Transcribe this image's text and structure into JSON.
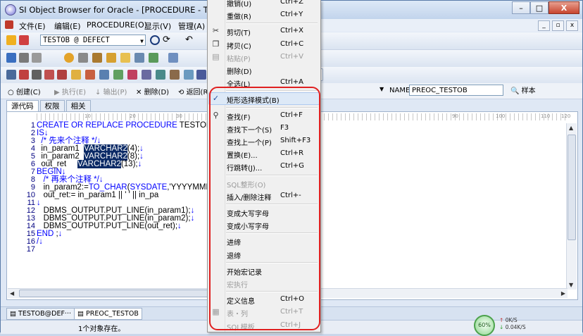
{
  "window": {
    "title": "SI Object Browser for Oracle - [PROCEDURE - TESTOB",
    "controls": [
      "–",
      "□",
      "X"
    ]
  },
  "menubar": {
    "items": [
      "文件(E)",
      "编辑(E)",
      "PROCEDURE(O)",
      "显示(V)",
      "管理(A)"
    ],
    "mdi_controls": [
      "_",
      "▫",
      "x"
    ]
  },
  "connection": {
    "value": "TESTOB @ DEFECT"
  },
  "actionbar": {
    "create": "创建(C)",
    "execute": "执行(E)",
    "output": "输出(P)",
    "delete": "删除(D)",
    "back": "返回(R)",
    "name_label": "NAME",
    "name_value": "PREOC_TESTOB",
    "sample": "样本"
  },
  "tabs": [
    "源代码",
    "权限",
    "相关"
  ],
  "ruler": [
    "10",
    "20",
    "30",
    "90",
    "100",
    "110",
    "120"
  ],
  "editor": {
    "line_numbers": [
      "1",
      "2",
      "3",
      "4",
      "5",
      "6",
      "7",
      "8",
      "9",
      "10",
      "11",
      "12",
      "13",
      "14",
      "15",
      "16",
      "17"
    ],
    "lines": [
      {
        "parts": [
          {
            "t": "CREATE OR REPLACE PROCEDURE",
            "c": "kw"
          },
          {
            "t": " TESTOB.PR"
          }
        ]
      },
      {
        "parts": [
          {
            "t": "IS",
            "c": "kw"
          },
          {
            "t": "↓",
            "c": "mark"
          }
        ]
      },
      {
        "parts": [
          {
            "t": "  /* 先来个注释 */",
            "c": "cm"
          },
          {
            "t": "↓",
            "c": "mark"
          }
        ]
      },
      {
        "parts": [
          {
            "t": "  in_param1  "
          },
          {
            "t": "VARCHAR2",
            "c": "sel"
          },
          {
            "t": "(4);"
          },
          {
            "t": "↓",
            "c": "mark"
          }
        ]
      },
      {
        "parts": [
          {
            "t": "  in_param2  "
          },
          {
            "t": "VARCHAR2",
            "c": "sel"
          },
          {
            "t": "(8);"
          },
          {
            "t": "↓",
            "c": "mark"
          }
        ]
      },
      {
        "parts": [
          {
            "t": "  out_ret     "
          },
          {
            "t": "VARCHAR2",
            "c": "sel"
          },
          {
            "t": "(13);"
          },
          {
            "t": "↓",
            "c": "mark"
          }
        ]
      },
      {
        "parts": [
          {
            "t": "BEGIN",
            "c": "kw"
          },
          {
            "t": "↓",
            "c": "mark"
          }
        ]
      },
      {
        "parts": [
          {
            "t": "   /* 再来个注释 */",
            "c": "cm"
          },
          {
            "t": "↓",
            "c": "mark"
          }
        ]
      },
      {
        "parts": [
          {
            "t": "   in_param2:="
          },
          {
            "t": "TO_CHAR",
            "c": "fn"
          },
          {
            "t": "("
          },
          {
            "t": "SYSDATE",
            "c": "fn"
          },
          {
            "t": ",'YYYYMMDD"
          }
        ]
      },
      {
        "parts": [
          {
            "t": "   out_ret:= in_param1 || ' ' || in_pa"
          }
        ]
      },
      {
        "parts": [
          {
            "t": "↓",
            "c": "mark"
          }
        ]
      },
      {
        "parts": [
          {
            "t": "   DBMS_OUTPUT.PUT_LINE(in_param1);"
          },
          {
            "t": "↓",
            "c": "mark"
          }
        ]
      },
      {
        "parts": [
          {
            "t": "   DBMS_OUTPUT.PUT_LINE(in_param2);"
          },
          {
            "t": "↓",
            "c": "mark"
          }
        ]
      },
      {
        "parts": [
          {
            "t": "   DBMS_OUTPUT.PUT_LINE(out_ret);"
          },
          {
            "t": "↓",
            "c": "mark"
          }
        ]
      },
      {
        "parts": [
          {
            "t": "END",
            "c": "kw"
          },
          {
            "t": " ;"
          },
          {
            "t": "↓",
            "c": "mark"
          }
        ]
      },
      {
        "parts": [
          {
            "t": "/",
            "c": "kw"
          },
          {
            "t": "↓",
            "c": "mark"
          }
        ]
      },
      {
        "parts": [
          {
            "t": ""
          }
        ]
      }
    ]
  },
  "doc_tabs": [
    "TESTOB@DEF···",
    "PREOC_TESTOB"
  ],
  "status": {
    "text": "1个对象存在。",
    "cpu": "60%",
    "up": "0K/S",
    "down": "0.04K/S"
  },
  "context_menu": {
    "items": [
      {
        "label": "撤销(U)",
        "shortcut": "Ctrl+Z",
        "disabled": false,
        "icon": ""
      },
      {
        "label": "重做(R)",
        "shortcut": "Ctrl+Y",
        "disabled": false,
        "icon": ""
      },
      {
        "sep": true
      },
      {
        "label": "剪切(T)",
        "shortcut": "Ctrl+X",
        "disabled": false,
        "icon": "scissors"
      },
      {
        "label": "拷贝(C)",
        "shortcut": "Ctrl+C",
        "disabled": false,
        "icon": "copy"
      },
      {
        "label": "粘贴(P)",
        "shortcut": "Ctrl+V",
        "disabled": true,
        "icon": "paste"
      },
      {
        "label": "删除(D)",
        "shortcut": "",
        "disabled": false,
        "icon": ""
      },
      {
        "label": "全选(L)",
        "shortcut": "Ctrl+A",
        "disabled": false,
        "icon": ""
      },
      {
        "sep": true
      },
      {
        "label": "矩形选择模式(B)",
        "shortcut": "",
        "disabled": false,
        "icon": "check",
        "checked": true
      },
      {
        "sep": true
      },
      {
        "label": "查找(F)",
        "shortcut": "Ctrl+F",
        "disabled": false,
        "icon": "binoculars"
      },
      {
        "label": "查找下一个(S)",
        "shortcut": "F3",
        "disabled": false,
        "icon": ""
      },
      {
        "label": "查找上一个(P)",
        "shortcut": "Shift+F3",
        "disabled": false,
        "icon": ""
      },
      {
        "label": "置换(E)...",
        "shortcut": "Ctrl+R",
        "disabled": false,
        "icon": ""
      },
      {
        "label": "行跳转(J)...",
        "shortcut": "Ctrl+G",
        "disabled": false,
        "icon": ""
      },
      {
        "sep": true
      },
      {
        "label": "SQL整形(O)",
        "shortcut": "",
        "disabled": true,
        "icon": ""
      },
      {
        "label": "插入/删除注释",
        "shortcut": "Ctrl+-",
        "disabled": false,
        "icon": ""
      },
      {
        "sep": true
      },
      {
        "label": "变成大写字母",
        "shortcut": "",
        "disabled": false,
        "icon": ""
      },
      {
        "label": "变成小写字母",
        "shortcut": "",
        "disabled": false,
        "icon": ""
      },
      {
        "sep": true
      },
      {
        "label": "进缔",
        "shortcut": "",
        "disabled": false,
        "icon": ""
      },
      {
        "label": "退缔",
        "shortcut": "",
        "disabled": false,
        "icon": ""
      },
      {
        "sep": true
      },
      {
        "label": "开始宏记录",
        "shortcut": "",
        "disabled": false,
        "icon": ""
      },
      {
        "label": "宏执行",
        "shortcut": "",
        "disabled": true,
        "icon": ""
      },
      {
        "sep": true
      },
      {
        "label": "定义信息",
        "shortcut": "Ctrl+O",
        "disabled": false,
        "icon": ""
      },
      {
        "label": "表・列",
        "shortcut": "Ctrl+T",
        "disabled": true,
        "icon": "table"
      },
      {
        "label": "SQL模板",
        "shortcut": "Ctrl+J",
        "disabled": true,
        "icon": ""
      }
    ]
  },
  "colors": {
    "keyword": "#0000ff",
    "selection": "#0b2a66",
    "ring": "#e02020"
  }
}
